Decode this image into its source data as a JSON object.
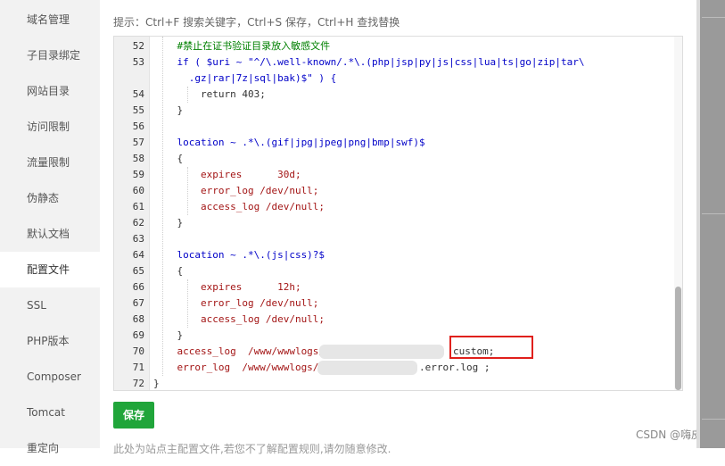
{
  "sidebar": {
    "items": [
      {
        "label": "域名管理",
        "active": false
      },
      {
        "label": "子目录绑定",
        "active": false
      },
      {
        "label": "网站目录",
        "active": false
      },
      {
        "label": "访问限制",
        "active": false
      },
      {
        "label": "流量限制",
        "active": false
      },
      {
        "label": "伪静态",
        "active": false
      },
      {
        "label": "默认文档",
        "active": false
      },
      {
        "label": "配置文件",
        "active": true
      },
      {
        "label": "SSL",
        "active": false
      },
      {
        "label": "PHP版本",
        "active": false
      },
      {
        "label": "Composer",
        "active": false
      },
      {
        "label": "Tomcat",
        "active": false
      },
      {
        "label": "重定向",
        "active": false
      }
    ]
  },
  "hint": "提示：Ctrl+F 搜索关键字，Ctrl+S 保存，Ctrl+H 查找替换",
  "editor": {
    "lines": [
      {
        "num": "52",
        "text": "    #禁止在证书验证目录放入敏感文件"
      },
      {
        "num": "53",
        "text": "    if ( $uri ~ \"^/\\.well-known/.*\\.(php|jsp|py|js|css|lua|ts|go|zip|tar\\"
      },
      {
        "num": "",
        "text": "      .gz|rar|7z|sql|bak)$\" ) {"
      },
      {
        "num": "54",
        "text": "        return 403;"
      },
      {
        "num": "55",
        "text": "    }"
      },
      {
        "num": "56",
        "text": ""
      },
      {
        "num": "57",
        "text": "    location ~ .*\\.(gif|jpg|jpeg|png|bmp|swf)$"
      },
      {
        "num": "58",
        "text": "    {"
      },
      {
        "num": "59",
        "text": "        expires      30d;"
      },
      {
        "num": "60",
        "text": "        error_log /dev/null;"
      },
      {
        "num": "61",
        "text": "        access_log /dev/null;"
      },
      {
        "num": "62",
        "text": "    }"
      },
      {
        "num": "63",
        "text": ""
      },
      {
        "num": "64",
        "text": "    location ~ .*\\.(js|css)?$"
      },
      {
        "num": "65",
        "text": "    {"
      },
      {
        "num": "66",
        "text": "        expires      12h;"
      },
      {
        "num": "67",
        "text": "        error_log /dev/null;"
      },
      {
        "num": "68",
        "text": "        access_log /dev/null;"
      },
      {
        "num": "69",
        "text": "    }"
      },
      {
        "num": "70",
        "text": "    access_log  /www/wwwlogs/"
      },
      {
        "num": "71",
        "text": "    error_log  /www/wwwlogs/"
      },
      {
        "num": "72",
        "text": "}"
      }
    ],
    "line70_tail": "custom;",
    "line71_tail": ".error.log ;"
  },
  "save_button": "保存",
  "bottom_note": "此处为站点主配置文件,若您不了解配置规则,请勿随意修改.",
  "watermark": "CSDN @嗨皮矫",
  "colors": {
    "accent": "#20a53a",
    "highlight": "#e0201c"
  }
}
